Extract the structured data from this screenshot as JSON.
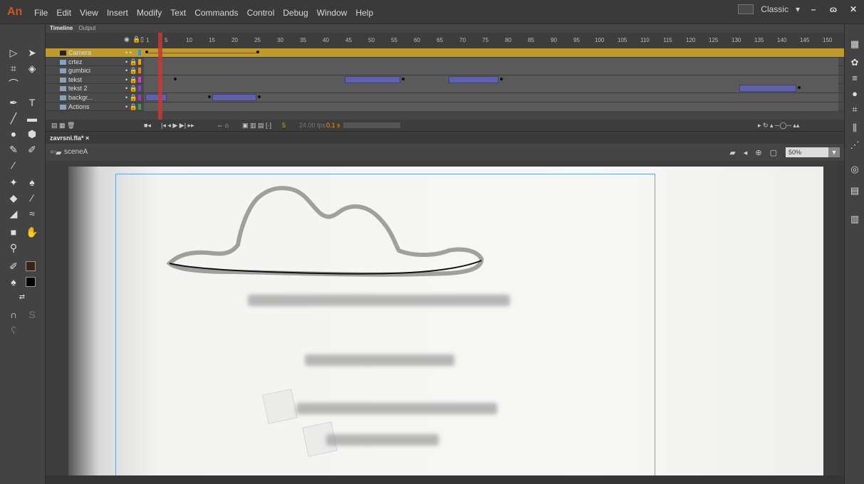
{
  "app": {
    "logo": "An"
  },
  "menu": [
    "File",
    "Edit",
    "View",
    "Insert",
    "Modify",
    "Text",
    "Commands",
    "Control",
    "Debug",
    "Window",
    "Help"
  ],
  "workspace": {
    "label": "Classic",
    "arrow": "▾"
  },
  "window_buttons": {
    "minimize": "–",
    "maximize": "ɷ",
    "close": "✕"
  },
  "timeline": {
    "tabs": [
      "Timeline",
      "Output"
    ],
    "frame_numbers": [
      "1",
      "5",
      "10",
      "15",
      "20",
      "25",
      "30",
      "35",
      "40",
      "45",
      "50",
      "55",
      "60",
      "65",
      "70",
      "75",
      "80",
      "85",
      "90",
      "95",
      "100",
      "105",
      "110",
      "115",
      "120",
      "125",
      "130",
      "135",
      "140",
      "145",
      "150"
    ],
    "layers": [
      {
        "name": "Camera",
        "color": "#2d9ad8"
      },
      {
        "name": "crtez",
        "color": "#f0a020"
      },
      {
        "name": "gumbici",
        "color": "#f07a20"
      },
      {
        "name": "tekst",
        "color": "#d040c0"
      },
      {
        "name": "tekst 2",
        "color": "#8040d0"
      },
      {
        "name": "backgr...",
        "color": "#b030c0"
      },
      {
        "name": "Actions",
        "color": "#40a040"
      }
    ],
    "fps": "24.00 fps",
    "time": "0.1 s",
    "frame_current": "5"
  },
  "document": {
    "tab": "zavrsni.fla*  ×",
    "scene": "sceneA",
    "zoom": "50%"
  }
}
